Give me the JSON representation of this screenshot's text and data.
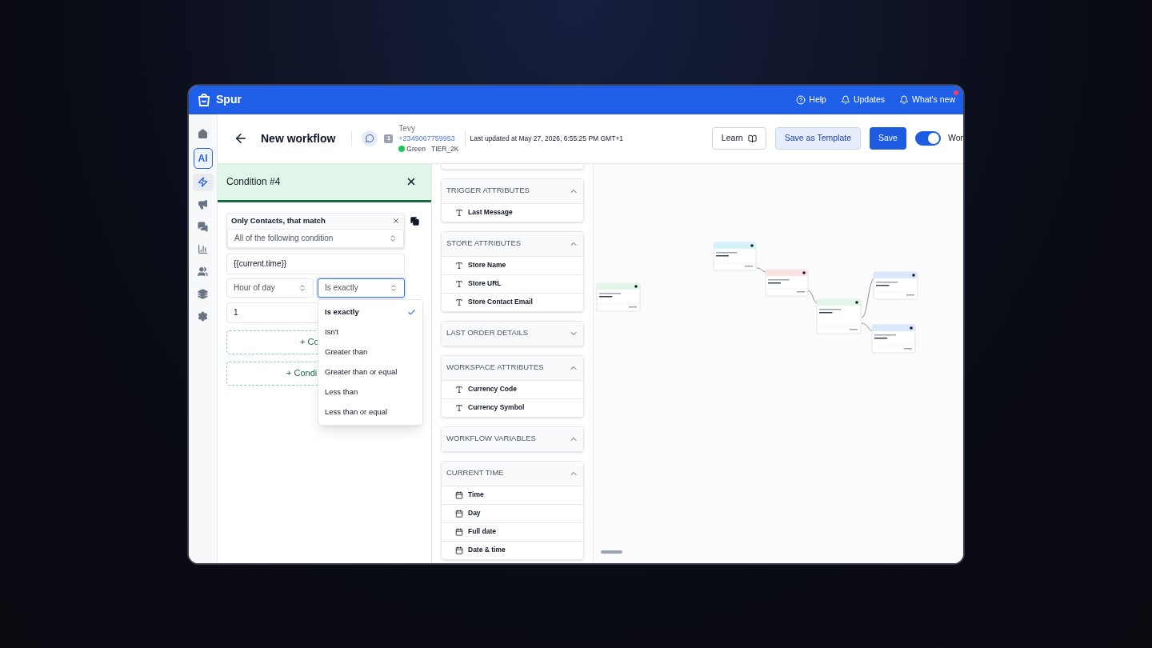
{
  "brand": "Spur",
  "top_links": [
    {
      "label": "Help",
      "kind": "help",
      "notification": false
    },
    {
      "label": "Updates",
      "kind": "bell",
      "notification": false
    },
    {
      "label": "What's new",
      "kind": "bell",
      "notification": true
    }
  ],
  "rail": [
    {
      "kind": "home",
      "selected": false
    },
    {
      "kind": "ai",
      "label": "AI",
      "selected": false
    },
    {
      "kind": "bolt",
      "selected": true
    },
    {
      "kind": "megaphone",
      "selected": false
    },
    {
      "kind": "chat",
      "selected": false
    },
    {
      "kind": "chart",
      "selected": false
    },
    {
      "kind": "users",
      "selected": false
    },
    {
      "kind": "stack",
      "selected": false
    },
    {
      "kind": "gear",
      "selected": false
    }
  ],
  "header": {
    "title": "New workflow",
    "contact": {
      "name": "Tevy",
      "channel_count": "1",
      "phone": "+2349067759953",
      "status": "Green",
      "tier": "TIER_2K"
    },
    "last_updated": "Last updated at May 27, 2026, 6:55:25 PM GMT+1",
    "buttons": [
      {
        "label": "Learn",
        "kind": "outline"
      },
      {
        "label": "Save as Template",
        "kind": "soft"
      },
      {
        "label": "Save",
        "kind": "primary"
      }
    ],
    "toggle": {
      "on": true,
      "label": "Wor"
    }
  },
  "condition_panel": {
    "title": "Condition #4",
    "group_label": "Only Contacts, that match",
    "match_select": "All of the following condition",
    "variable": "{{current.time}}",
    "unit_select": "Hour of day",
    "operator_select": {
      "value": "Is exactly",
      "open": true
    },
    "value_input": "1",
    "options": [
      {
        "label": "Is exactly",
        "selected": true
      },
      {
        "label": "Isn't",
        "selected": false
      },
      {
        "label": "Greater than",
        "selected": false
      },
      {
        "label": "Greater than or equal",
        "selected": false
      },
      {
        "label": "Less than",
        "selected": false
      },
      {
        "label": "Less than or equal",
        "selected": false
      }
    ],
    "add_buttons": [
      "+ Co",
      "+ Condi"
    ]
  },
  "variables": [
    {
      "title": "TRIGGER ATTRIBUTES",
      "expanded": true,
      "items": [
        {
          "label": "Last Message",
          "kind": "text"
        }
      ]
    },
    {
      "title": "STORE ATTRIBUTES",
      "expanded": true,
      "items": [
        {
          "label": "Store Name",
          "kind": "text"
        },
        {
          "label": "Store URL",
          "kind": "text"
        },
        {
          "label": "Store Contact Email",
          "kind": "text"
        }
      ]
    },
    {
      "title": "LAST ORDER DETAILS",
      "expanded": false
    },
    {
      "title": "WORKSPACE ATTRIBUTES",
      "expanded": true,
      "items": [
        {
          "label": "Currency Code",
          "kind": "text"
        },
        {
          "label": "Currency Symbol",
          "kind": "text"
        }
      ]
    },
    {
      "title": "WORKFLOW VARIABLES",
      "expanded": true
    },
    {
      "title": "CURRENT TIME",
      "expanded": true,
      "items": [
        {
          "label": "Time",
          "kind": "date"
        },
        {
          "label": "Day",
          "kind": "date"
        },
        {
          "label": "Full date",
          "kind": "date"
        },
        {
          "label": "Date & time",
          "kind": "date"
        }
      ]
    }
  ]
}
